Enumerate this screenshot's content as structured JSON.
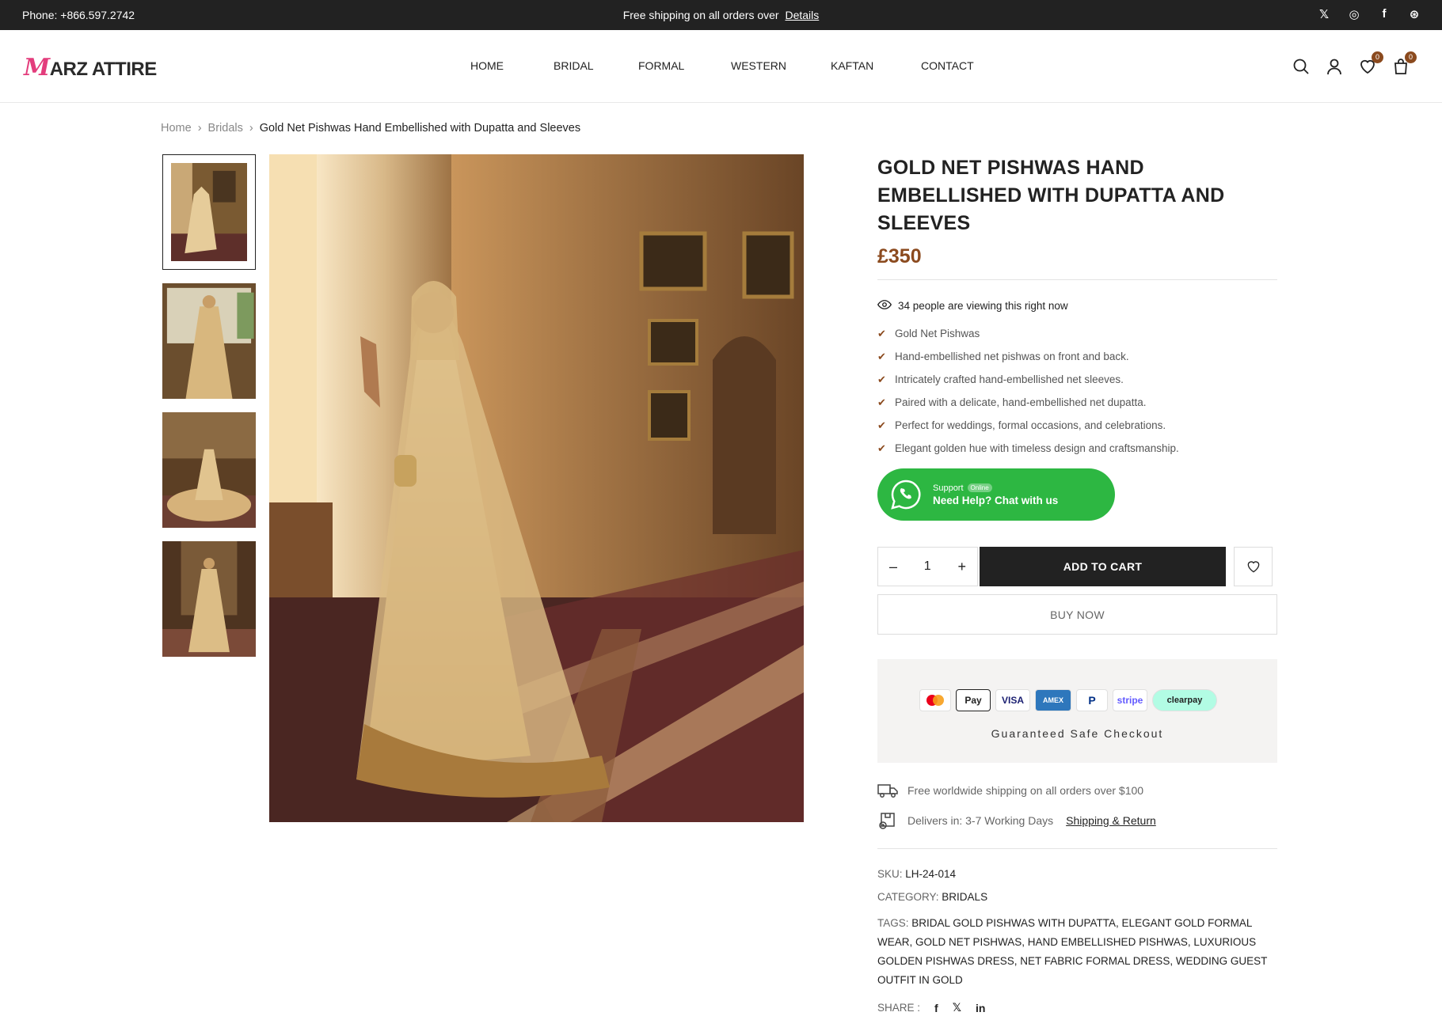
{
  "topbar": {
    "phone": "Phone: +866.597.2742",
    "promo": "Free shipping on all orders over",
    "promo_link": "Details",
    "socials": [
      {
        "icon": "x-icon",
        "glyph": "𝕏"
      },
      {
        "icon": "instagram-icon",
        "glyph": "◎"
      },
      {
        "icon": "facebook-icon",
        "glyph": "f"
      },
      {
        "icon": "dribbble-icon",
        "glyph": "⊛"
      }
    ]
  },
  "header": {
    "logo_m": "M",
    "logo_rest": "ARZ ATTIRE",
    "nav": [
      "HOME",
      "BRIDAL",
      "FORMAL",
      "WESTERN",
      "KAFTAN",
      "CONTACT"
    ],
    "wishlist_count": "0",
    "cart_count": "0"
  },
  "breadcrumb": {
    "items": [
      "Home",
      "Bridals",
      "Gold Net Pishwas Hand Embellished with Dupatta and Sleeves"
    ],
    "separator": "›"
  },
  "product": {
    "title": "GOLD NET PISHWAS HAND EMBELLISHED WITH DUPATTA AND SLEEVES",
    "price": "£350",
    "viewing": "34 people are viewing this right now",
    "features": [
      "Gold Net Pishwas",
      "Hand-embellished net pishwas on front and back.",
      "Intricately crafted hand-embellished net sleeves.",
      "Paired with a delicate, hand-embellished net dupatta.",
      "Perfect for weddings, formal occasions, and celebrations.",
      "Elegant golden hue with timeless design and craftsmanship."
    ],
    "support": {
      "label": "Support",
      "status": "Online",
      "cta": "Need Help? Chat with us"
    },
    "quantity": "1",
    "add_to_cart": "ADD TO CART",
    "buy_now": "BUY NOW",
    "payments": [
      "Mastercard",
      "Pay",
      "VISA",
      "AMEX",
      "P",
      "stripe",
      "clearpay"
    ],
    "guaranteed": "Guaranteed Safe Checkout",
    "shipping": "Free worldwide shipping on all orders over $100",
    "delivery": "Delivers in: 3-7 Working Days",
    "delivery_link": "Shipping & Return",
    "sku_label": "SKU:",
    "sku": "LH-24-014",
    "category_label": "CATEGORY:",
    "category": "BRIDALS",
    "tags_label": "TAGS:",
    "tags": [
      "BRIDAL GOLD PISHWAS WITH DUPATTA",
      "ELEGANT GOLD FORMAL WEAR",
      "GOLD NET PISHWAS",
      "HAND EMBELLISHED PISHWAS",
      "LUXURIOUS GOLDEN PISHWAS DRESS",
      "NET FABRIC FORMAL DRESS",
      "WEDDING GUEST OUTFIT IN GOLD"
    ],
    "tags_joined": "BRIDAL GOLD PISHWAS WITH DUPATTA, ELEGANT GOLD FORMAL WEAR, GOLD NET PISHWAS, HAND EMBELLISHED PISHWAS, LUXURIOUS GOLDEN PISHWAS DRESS, NET FABRIC FORMAL DRESS, WEDDING GUEST OUTFIT IN GOLD",
    "share_label": "SHARE :",
    "share_icons": [
      "facebook-icon",
      "x-icon",
      "linkedin-icon"
    ]
  },
  "colors": {
    "accent": "#8b4a1e",
    "whatsapp": "#2db742",
    "dark": "#222222"
  }
}
